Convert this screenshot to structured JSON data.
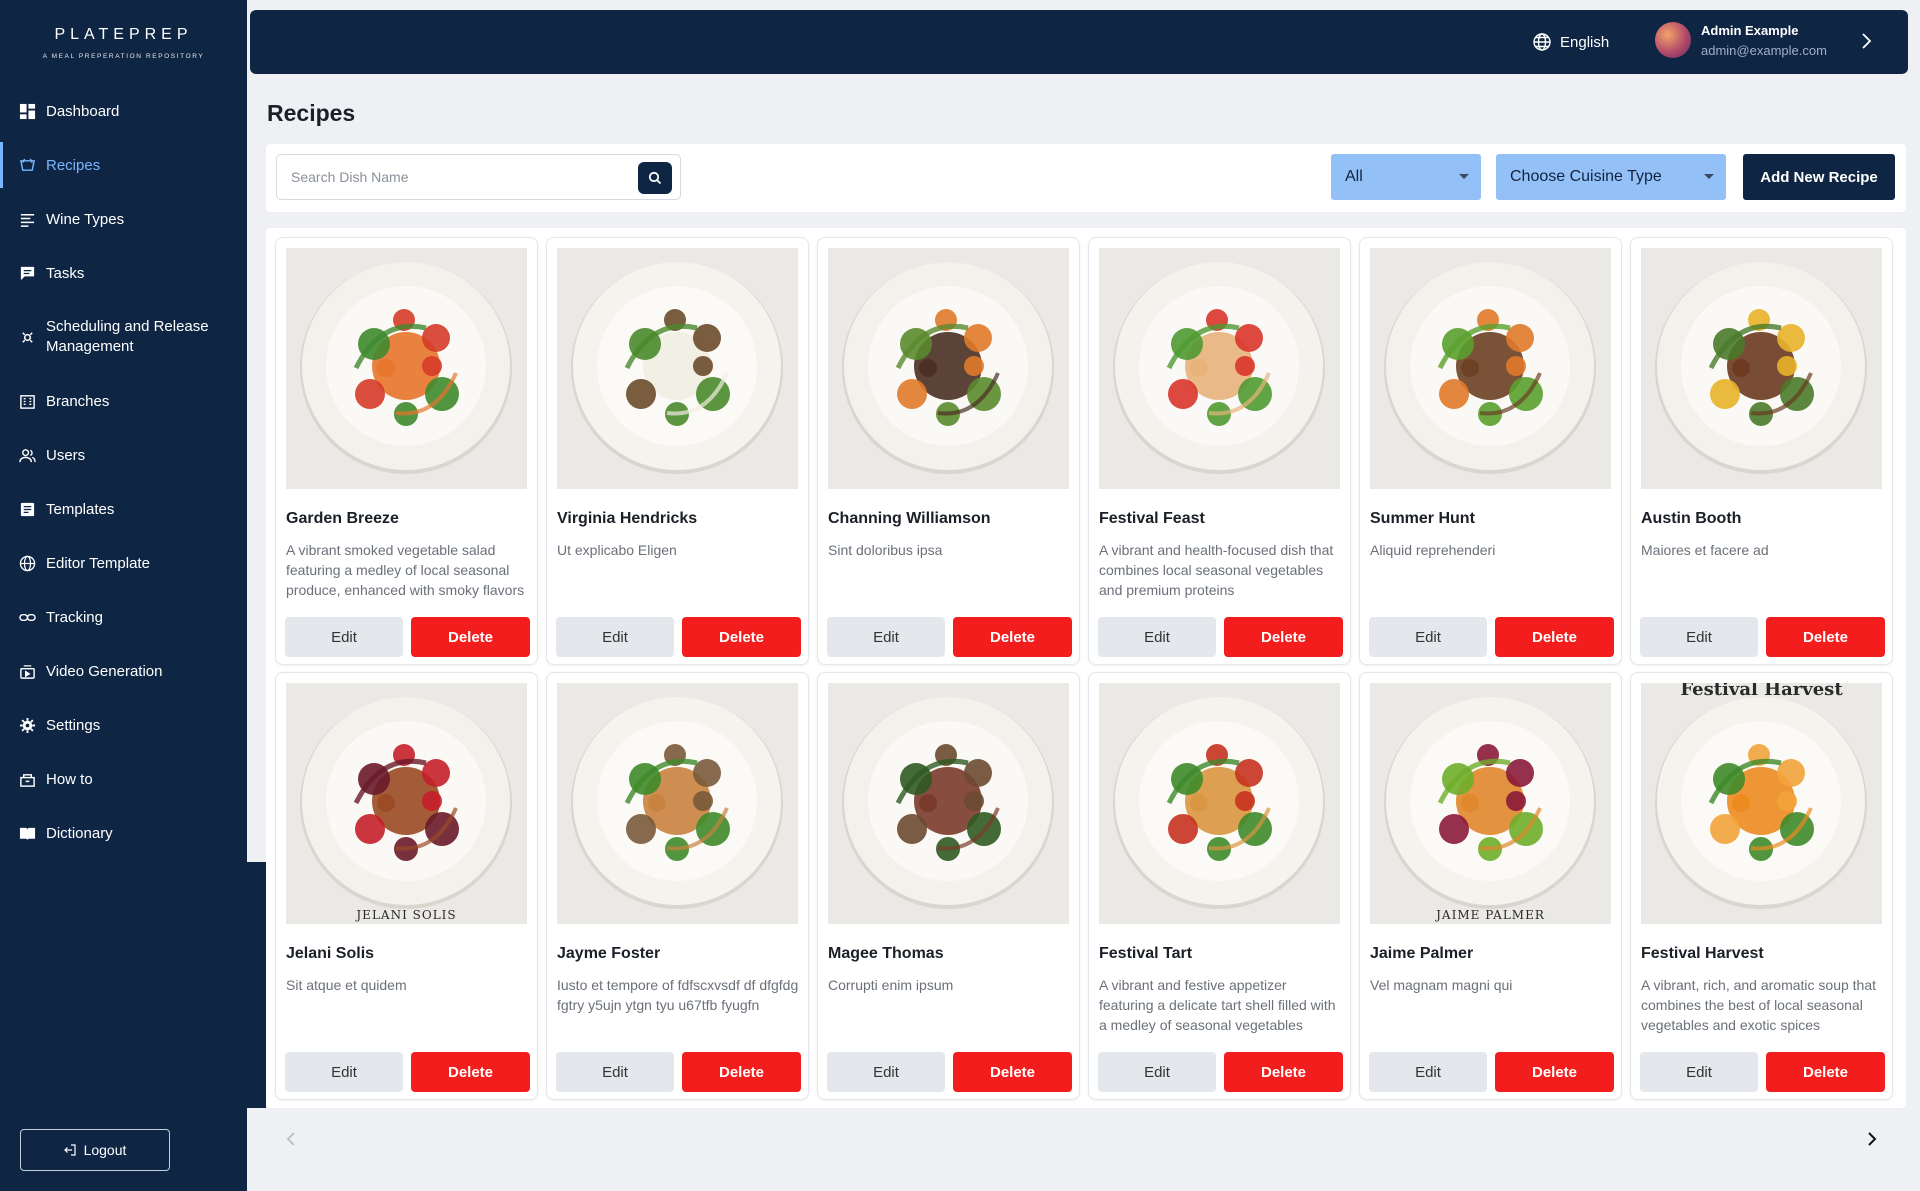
{
  "brand": {
    "name": "PLATEPREP",
    "tagline": "A MEAL PREPERATION REPOSITORY"
  },
  "sidebar": {
    "items": [
      {
        "label": "Dashboard",
        "icon": "dashboard-icon"
      },
      {
        "label": "Recipes",
        "icon": "recipes-icon",
        "active": true
      },
      {
        "label": "Wine Types",
        "icon": "list-icon"
      },
      {
        "label": "Tasks",
        "icon": "chat-icon"
      },
      {
        "label": "Scheduling and Release Management",
        "icon": "schedule-icon"
      },
      {
        "label": "Branches",
        "icon": "building-icon"
      },
      {
        "label": "Users",
        "icon": "users-icon"
      },
      {
        "label": "Templates",
        "icon": "template-icon"
      },
      {
        "label": "Editor Template",
        "icon": "globe-icon"
      },
      {
        "label": "Tracking",
        "icon": "link-icon"
      },
      {
        "label": "Video Generation",
        "icon": "video-icon"
      },
      {
        "label": "Settings",
        "icon": "gear-icon"
      },
      {
        "label": "How to",
        "icon": "help-icon"
      },
      {
        "label": "Dictionary",
        "icon": "book-icon"
      }
    ],
    "logout_label": "Logout"
  },
  "header": {
    "language": "English",
    "user_name": "Admin Example",
    "user_email": "admin@example.com"
  },
  "page": {
    "title": "Recipes",
    "search_placeholder": "Search Dish Name",
    "filter_all": "All",
    "filter_cuisine": "Choose Cuisine Type",
    "add_button": "Add New Recipe",
    "edit_label": "Edit",
    "delete_label": "Delete"
  },
  "recipes": [
    {
      "title": "Garden Breeze",
      "desc": "A vibrant smoked vegetable salad featuring a medley of local seasonal produce, enhanced with smoky flavors",
      "plate": "#f4f1ec",
      "a": "#e8742b",
      "b": "#3f8a2e",
      "c": "#d63b2a"
    },
    {
      "title": "Virginia Hendricks",
      "desc": "Ut explicabo Eligen",
      "plate": "#f6f3ee",
      "a": "#f1ede2",
      "b": "#4a8a2a",
      "c": "#6b4a2a"
    },
    {
      "title": "Channing Williamson",
      "desc": "Sint doloribus ipsa",
      "plate": "#f4f1ec",
      "a": "#4a2f22",
      "b": "#5a8a2e",
      "c": "#e07a2a"
    },
    {
      "title": "Festival Feast",
      "desc": "A vibrant and health-focused dish that combines local seasonal vegetables and premium proteins",
      "plate": "#f5f2ed",
      "a": "#e7b37a",
      "b": "#4f9a32",
      "c": "#d9352a"
    },
    {
      "title": "Summer Hunt",
      "desc": "Aliquid reprehenderi",
      "plate": "#f4f1ec",
      "a": "#6a3f24",
      "b": "#5aa02e",
      "c": "#e0792a"
    },
    {
      "title": "Austin Booth",
      "desc": "Maiores et facere ad",
      "plate": "#f4f1ec",
      "a": "#6a3a20",
      "b": "#4a7a2a",
      "c": "#e8b22a"
    },
    {
      "title": "Jelani Solis",
      "desc": "Sit atque et quidem",
      "plate": "#f4f1ec",
      "a": "#9a4a24",
      "b": "#6a1a2a",
      "c": "#c41f2a",
      "caption": "JELANI SOLIS"
    },
    {
      "title": "Jayme Foster",
      "desc": "Iusto et tempore of fdfscxvsdf df dfgfdg fgtry y5ujn ytgn tyu u67tfb fyugfn",
      "plate": "#f6f3ee",
      "a": "#c9823f",
      "b": "#3f8a2a",
      "c": "#7a5a3a"
    },
    {
      "title": "Magee Thomas",
      "desc": "Corrupti enim ipsum",
      "plate": "#f4f1ec",
      "a": "#7a3a2a",
      "b": "#2f5a22",
      "c": "#6a4a30"
    },
    {
      "title": "Festival Tart",
      "desc": "A vibrant and festive appetizer featuring a delicate tart shell filled with a medley of seasonal vegetables",
      "plate": "#f6f3ee",
      "a": "#d9963f",
      "b": "#3f8a2a",
      "c": "#c6321f"
    },
    {
      "title": "Jaime Palmer",
      "desc": "Vel magnam magni qui",
      "plate": "#f6f3ee",
      "a": "#e0862a",
      "b": "#6fae2a",
      "c": "#8a1a3a",
      "caption": "JAIME PALMER"
    },
    {
      "title": "Festival Harvest",
      "desc": "A vibrant, rich, and aromatic soup that combines the best of local seasonal vegetables and exotic spices",
      "plate": "#f6f3ee",
      "a": "#ec8a1f",
      "b": "#3f8a2a",
      "c": "#f2a33a",
      "caption": "Festival Harvest"
    }
  ]
}
